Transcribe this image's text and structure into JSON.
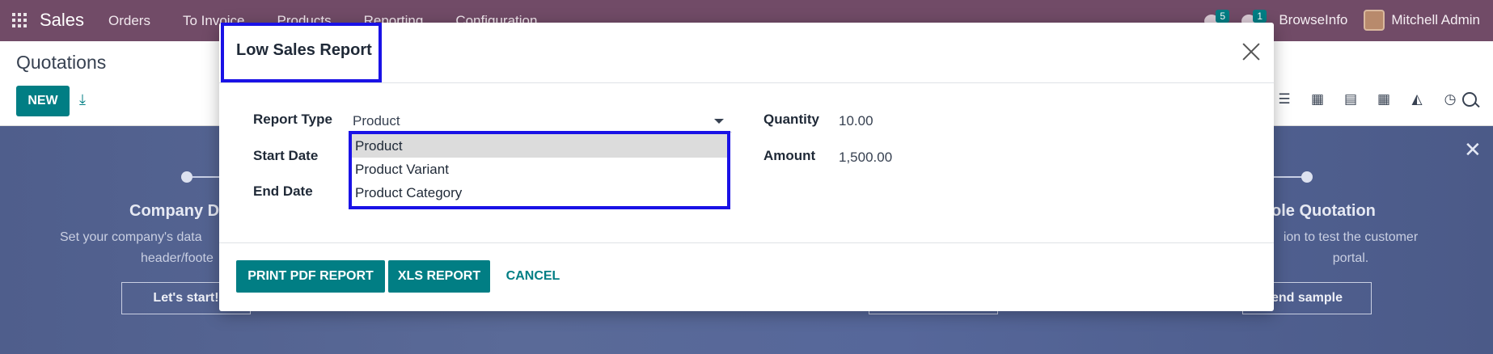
{
  "navbar": {
    "brand": "Sales",
    "menu": [
      "Orders",
      "To Invoice",
      "Products",
      "Reporting",
      "Configuration"
    ],
    "messages_count": "5",
    "activities_count": "1",
    "company": "BrowseInfo",
    "user": "Mitchell Admin"
  },
  "control_panel": {
    "title": "Quotations",
    "new_label": "NEW"
  },
  "banner": {
    "step1_title": "Company D",
    "step1_text_1": "Set your company's data",
    "step1_text_2": "header/foote",
    "step1_button": "Let's start!",
    "step3_title": "ole Quotation",
    "step3_text_1": "ion to test the customer",
    "step3_text_2": "portal.",
    "step3_button": "end sample"
  },
  "modal": {
    "title": "Low Sales Report",
    "report_type_label": "Report Type",
    "report_type_value": "Product",
    "start_date_label": "Start Date",
    "end_date_label": "End Date",
    "quantity_label": "Quantity",
    "quantity_value": "10.00",
    "amount_label": "Amount",
    "amount_value": "1,500.00",
    "dropdown_options": [
      "Product",
      "Product Variant",
      "Product Category"
    ],
    "print_pdf_label": "PRINT PDF REPORT",
    "xls_label": "XLS REPORT",
    "cancel_label": "CANCEL"
  },
  "colors": {
    "navbar": "#714b67",
    "primary": "#017e84",
    "highlight_box": "#1a12e6"
  }
}
